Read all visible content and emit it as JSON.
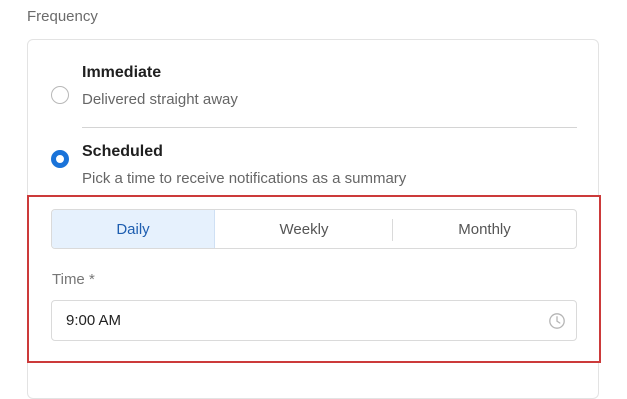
{
  "frequency": {
    "label": "Frequency",
    "options": [
      {
        "title": "Immediate",
        "description": "Delivered straight away",
        "selected": false
      },
      {
        "title": "Scheduled",
        "description": "Pick a time to receive notifications as a summary",
        "selected": true
      }
    ]
  },
  "schedule": {
    "tabs": [
      {
        "label": "Daily",
        "active": true
      },
      {
        "label": "Weekly",
        "active": false
      },
      {
        "label": "Monthly",
        "active": false
      }
    ],
    "time": {
      "label": "Time *",
      "value": "9:00 AM",
      "icon": "clock-icon"
    }
  },
  "colors": {
    "accent": "#1a73d9",
    "active_tab_bg": "#e6f1fd",
    "highlight_border": "#cc3a3a"
  }
}
